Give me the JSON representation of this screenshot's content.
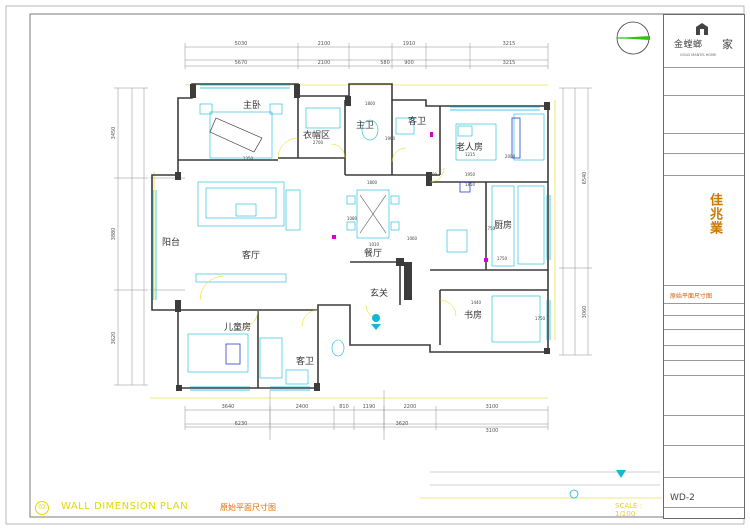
{
  "plan": {
    "rooms": {
      "master_bedroom": "主卧",
      "closet": "衣帽区",
      "master_bath": "主卫",
      "guest_bath_top": "客卫",
      "elderly_room": "老人房",
      "balcony": "阳台",
      "living_room": "客厅",
      "dining_room": "餐厅",
      "kitchen": "厨房",
      "entrance": "玄关",
      "study": "书房",
      "kids_room": "儿童房",
      "guest_bath_bottom": "客卫"
    },
    "dims_top_outer": [
      "5030",
      "2100",
      "1910",
      "3215"
    ],
    "dims_top_inner": [
      "5670",
      "2100",
      "580",
      "900",
      "3215"
    ],
    "dims_bottom_inner": [
      "3640",
      "2400",
      "810",
      "1190",
      "2200",
      "3100"
    ],
    "dims_bottom_mid": [
      "6230",
      "3620",
      "3100"
    ],
    "dims_left": [
      "3450",
      "3880",
      "3620"
    ],
    "dims_right": [
      "6540",
      "3060"
    ],
    "small_dims": [
      "1800",
      "1350",
      "2700",
      "1900",
      "1800",
      "1080",
      "1200",
      "1750",
      "1950",
      "2000",
      "1010",
      "1850",
      "1215",
      "1060",
      "1750",
      "1750",
      "1440"
    ]
  },
  "title_block": {
    "logo_text": "金螳螂",
    "logo_suffix": "家",
    "logo_sub": "GOLD MANTIS HOME",
    "project_name": "佳兆業",
    "drawing_name": "原始平面尺寸图",
    "drawing_no": "WD-2"
  },
  "bottom": {
    "number": "02",
    "title_en": "WALL DIMENSION PLAN",
    "title_cn": "原始平面尺寸图",
    "scale": "SCALE : 1/100"
  }
}
